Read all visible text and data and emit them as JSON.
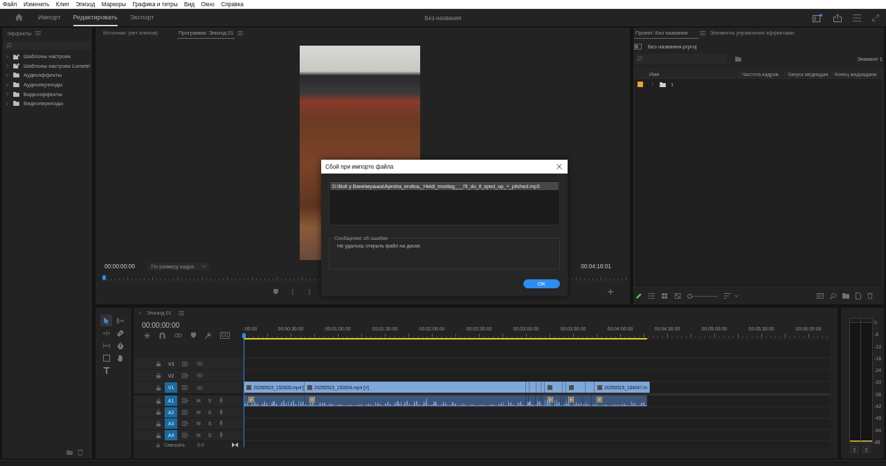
{
  "menu_bar": [
    "Файл",
    "Изменить",
    "Клип",
    "Эпизод",
    "Маркеры",
    "Графика и титры",
    "Вид",
    "Окно",
    "Справка"
  ],
  "workspace_tabs": [
    {
      "label": "Импорт",
      "selected": false
    },
    {
      "label": "Редактировать",
      "selected": true
    },
    {
      "label": "Экспорт",
      "selected": false
    }
  ],
  "project_title": "Без названия",
  "effects_panel": {
    "title": "Эффекты",
    "items": [
      {
        "label": "Шаблоны настроек",
        "kind": "preset"
      },
      {
        "label": "Шаблоны настроек Lumetri",
        "kind": "preset"
      },
      {
        "label": "Аудиоэффекты",
        "kind": "folder"
      },
      {
        "label": "Аудиопереходы",
        "kind": "folder"
      },
      {
        "label": "Видеоэффекты",
        "kind": "folder"
      },
      {
        "label": "Видеопереходы",
        "kind": "folder"
      }
    ]
  },
  "program_monitor": {
    "tabs": [
      {
        "label": "Источник: (нет клипов)",
        "selected": false
      },
      {
        "label": "Программа: Эпизод 01",
        "selected": true
      }
    ],
    "timecode": "00:00:00:00",
    "zoom": "По размеру кадра",
    "duration": "00:04:18:01"
  },
  "project_panel": {
    "tabs": [
      {
        "label": "Проект: Без названия",
        "selected": true
      },
      {
        "label": "Элементы управления эффектами",
        "selected": false
      }
    ],
    "file": "Без названия.prproj",
    "item_count": "Элемент 1",
    "columns": [
      "Имя",
      "Частота кадров",
      "Запуск медиадан",
      "Конец медиадани"
    ],
    "rows": [
      {
        "name": "1",
        "kind": "bin",
        "color": "#eea22e"
      }
    ],
    "zoom_slider": {
      "level": 0
    }
  },
  "tools_panel": {
    "tools": [
      {
        "kind": "selection",
        "selected": true
      },
      {
        "kind": "track_select",
        "selected": false
      },
      {
        "kind": "ripple_edit",
        "selected": false
      },
      {
        "kind": "razor",
        "selected": false
      },
      {
        "kind": "slip",
        "selected": false
      },
      {
        "kind": "pen",
        "selected": false
      },
      {
        "kind": "rectangle",
        "selected": false
      },
      {
        "kind": "hand",
        "selected": false
      },
      {
        "kind": "type",
        "selected": false
      }
    ]
  },
  "timeline": {
    "tab": "Эпизод 01",
    "timecode": "00:00:00:00",
    "captions_button": "CC",
    "ruler": [
      ":00:00",
      "00:00:30:00",
      "00:01:00:00",
      "00:01:30:00",
      "00:02:00:00",
      "00:02:30:00",
      "00:03:00:00",
      "00:03:30:00",
      "00:04:00:00",
      "00:04:30:00",
      "00:05:00:00",
      "00:05:30:00",
      "00:06:00:00"
    ],
    "tracks": [
      {
        "label": "V3",
        "kind": "video",
        "targeted": false
      },
      {
        "label": "V2",
        "kind": "video",
        "targeted": false
      },
      {
        "label": "V1",
        "kind": "video",
        "targeted": true
      },
      {
        "label": "A1",
        "kind": "audio",
        "targeted": true,
        "buttons": [
          "M",
          "S"
        ]
      },
      {
        "label": "A2",
        "kind": "audio",
        "targeted": true,
        "buttons": [
          "M",
          "S"
        ]
      },
      {
        "label": "A3",
        "kind": "audio",
        "targeted": true,
        "buttons": [
          "M",
          "S"
        ]
      },
      {
        "label": "A4",
        "kind": "audio",
        "targeted": true,
        "buttons": [
          "M",
          "S"
        ]
      }
    ],
    "clips": [
      {
        "name": "20250515_152835.mp4 ["
      },
      {
        "name": "20250515_153004.mp4 [V]"
      },
      {
        "name": "20250515_164047.m"
      }
    ],
    "mix": {
      "label": "Смешать",
      "value": "0.0"
    }
  },
  "audio_meter": {
    "scale": [
      "0",
      "-6",
      "-12",
      "-18",
      "-24",
      "-30",
      "-36",
      "-42",
      "-48",
      "-54",
      "dB"
    ],
    "solo_buttons": [
      "S",
      "S"
    ]
  },
  "dialog": {
    "title": "Сбой при импорте файла",
    "files": [
      {
        "path": "D:\\Всё у Вани\\музыка\\Ayesha_erotica,_Heidi_montag___I'll_do_it_sped_up_+_pitched.mp3",
        "selected": true
      }
    ],
    "error_label": "Сообщение об ошибке",
    "error_text": "Не удалось открыть файл на диске.",
    "ok_button": "OK"
  }
}
